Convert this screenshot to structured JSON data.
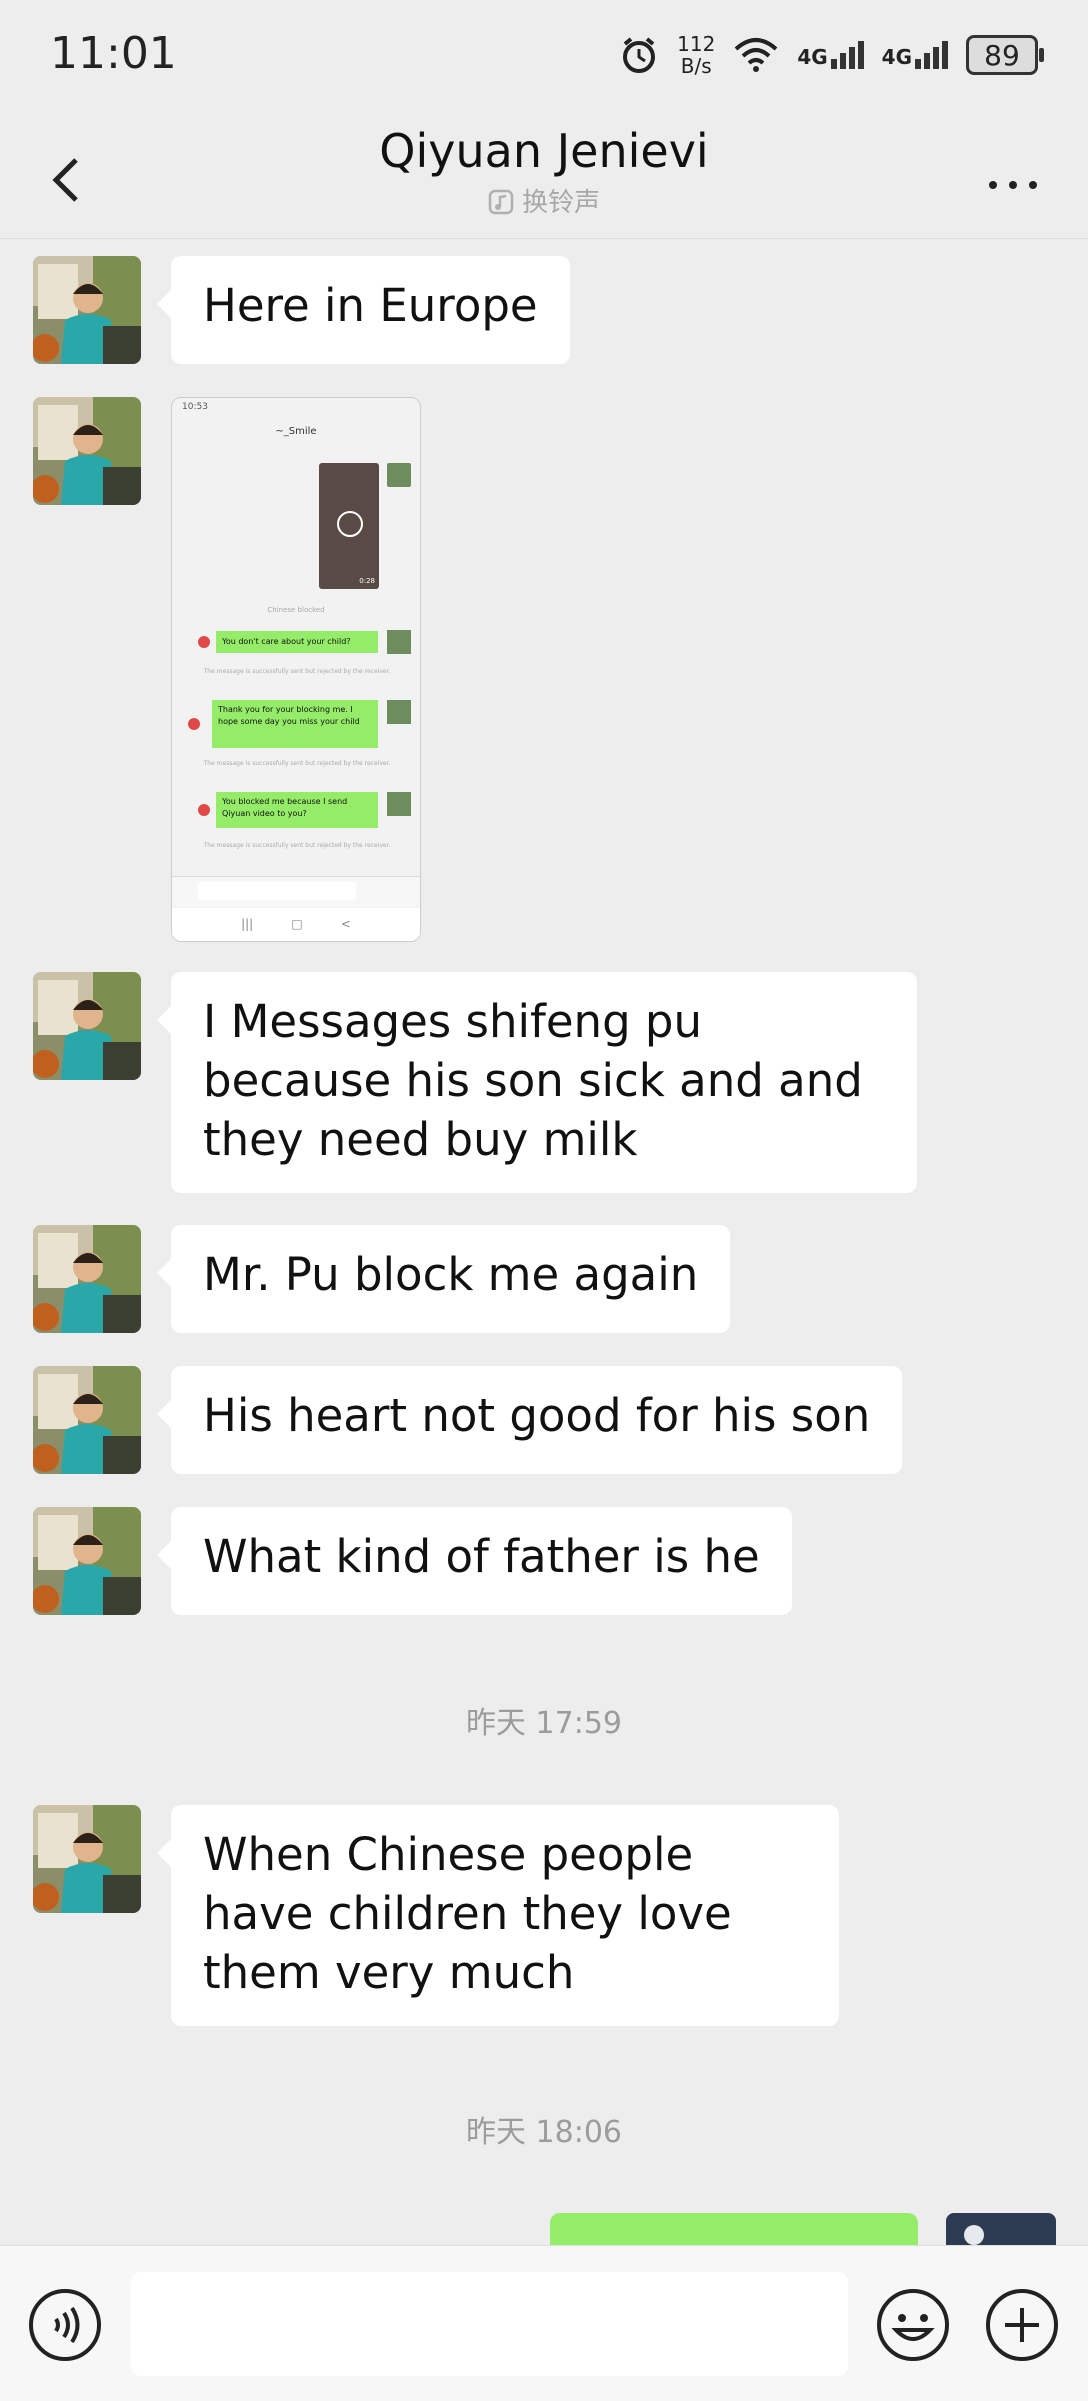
{
  "status_bar": {
    "time": "11:01",
    "net_speed_value": "112",
    "net_speed_unit": "B/s",
    "network_1": "4G",
    "network_2": "4G",
    "battery": "89"
  },
  "header": {
    "title": "Qiyuan  Jenievi",
    "subtitle": "换铃声"
  },
  "messages": [
    {
      "text": "Here in Europe"
    },
    {
      "text": "I Messages shifeng pu because his son sick and and they need buy milk"
    },
    {
      "text": "Mr. Pu block me again"
    },
    {
      "text": "His heart not good for his son"
    },
    {
      "text": "What kind of father is he"
    },
    {
      "text": "When Chinese people have children they love them very much"
    }
  ],
  "timestamps": [
    "昨天 17:59",
    "昨天 18:06"
  ],
  "screenshot": {
    "time": "10:53",
    "title": "~_Smile",
    "system_line": "Chinese blocked",
    "msgs": [
      "You don't care about your child?",
      "Thank you for your blocking me. I hope some day you miss your child",
      "You blocked me because I send Qiyuan video to you?"
    ],
    "rejected": "The message is successfully sent but rejected by the receiver.",
    "video_duration": "0:28"
  },
  "colors": {
    "background": "#ededed",
    "bubble_incoming": "#ffffff",
    "bubble_outgoing": "#95ec69",
    "timestamp": "#9c9c9c"
  }
}
